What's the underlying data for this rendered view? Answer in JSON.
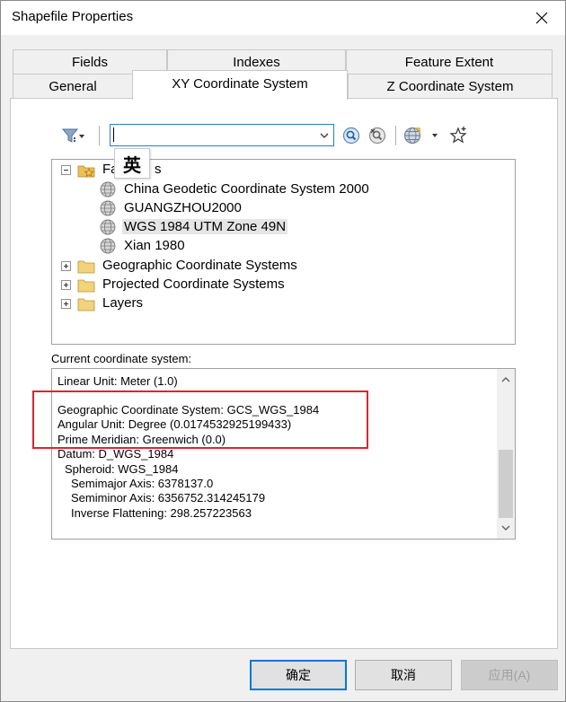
{
  "window": {
    "title": "Shapefile Properties"
  },
  "tabs": {
    "row_top": [
      {
        "label": "Fields"
      },
      {
        "label": "Indexes"
      },
      {
        "label": "Feature Extent"
      }
    ],
    "row_bottom": [
      {
        "label": "General"
      },
      {
        "label": "XY Coordinate System",
        "active": true
      },
      {
        "label": "Z Coordinate System"
      }
    ]
  },
  "toolbar": {
    "search_value": "",
    "ime_indicator": "英",
    "icons": [
      "filter-icon",
      "search-icon",
      "clear-search-icon",
      "globe-icon",
      "add-favorite-icon"
    ]
  },
  "tree": {
    "items": [
      {
        "label": "Favorites",
        "visible_text": "Fa",
        "visible_tail": "s",
        "expanded": true
      },
      {
        "label": "China Geodetic Coordinate System 2000"
      },
      {
        "label": "GUANGZHOU2000"
      },
      {
        "label": "WGS 1984 UTM Zone 49N",
        "selected": true
      },
      {
        "label": "Xian 1980"
      },
      {
        "label": "Geographic Coordinate Systems",
        "expanded": false
      },
      {
        "label": "Projected Coordinate Systems",
        "expanded": false
      },
      {
        "label": "Layers",
        "expanded": false
      }
    ]
  },
  "current_cs": {
    "label": "Current coordinate system:",
    "lines": [
      "Linear Unit: Meter (1.0)",
      "",
      "Geographic Coordinate System: GCS_WGS_1984",
      "Angular Unit: Degree (0.0174532925199433)",
      "Prime Meridian: Greenwich (0.0)",
      "Datum: D_WGS_1984",
      "  Spheroid: WGS_1984",
      "    Semimajor Axis: 6378137.0",
      "    Semiminor Axis: 6356752.314245179",
      "    Inverse Flattening: 298.257223563"
    ]
  },
  "buttons": {
    "ok": "确定",
    "cancel": "取消",
    "apply": "应用(A)"
  },
  "colors": {
    "accent": "#0078d7",
    "highlight": "#d9262c"
  }
}
